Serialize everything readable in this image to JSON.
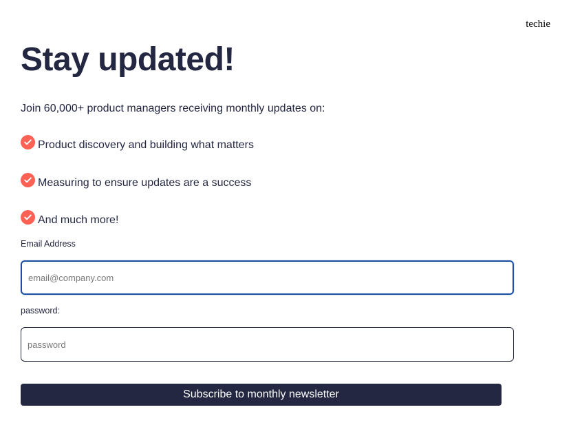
{
  "brand": {
    "name": "techie"
  },
  "hero": {
    "title": "Stay updated!",
    "intro": "Join 60,000+ product managers receiving monthly updates on:"
  },
  "features": [
    {
      "icon": "check-circle-icon",
      "text": "Product discovery and building what matters"
    },
    {
      "icon": "check-circle-icon",
      "text": "Measuring to ensure updates are a success"
    },
    {
      "icon": "check-circle-icon",
      "text": "And much more!"
    }
  ],
  "form": {
    "email_label": "Email Address",
    "email_value": "",
    "email_placeholder": "email@company.com",
    "password_label": "password:",
    "password_value": "",
    "password_placeholder": "password",
    "submit_label": "Subscribe to monthly newsletter"
  },
  "colors": {
    "text": "#242742",
    "accent": "#ff6155",
    "focus": "#1c4fa3",
    "button": "#242742"
  }
}
